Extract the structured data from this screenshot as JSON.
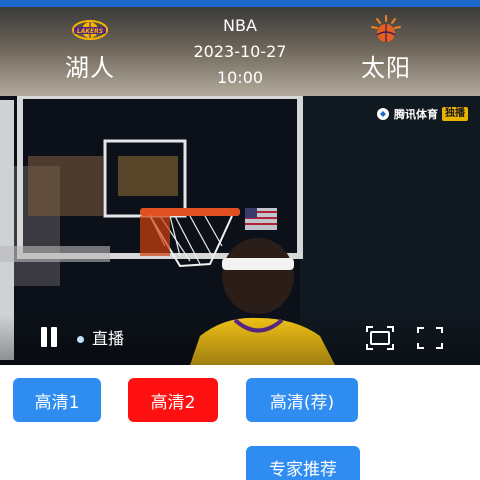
{
  "match": {
    "league": "NBA",
    "date": "2023-10-27",
    "time": "10:00",
    "home_team": {
      "name": "湖人",
      "logo_icon": "lakers-logo-icon"
    },
    "away_team": {
      "name": "太阳",
      "logo_icon": "suns-logo-icon"
    }
  },
  "player": {
    "watermark_text": "腾讯体育",
    "watermark_badge": "独播",
    "live_label": "直播",
    "state": "playing"
  },
  "sources": {
    "buttons": [
      {
        "label": "高清1",
        "color": "#2f8cf0",
        "selected": false
      },
      {
        "label": "高清2",
        "color": "#ff1010",
        "selected": true
      },
      {
        "label": "高清(荐)",
        "color": "#2f8cf0",
        "selected": false
      },
      {
        "label": "专家推荐",
        "color": "#2f8cf0",
        "selected": false
      }
    ]
  },
  "colors": {
    "accent": "#2f8cf0",
    "selected": "#ff1010",
    "status_strip": "#1e68c9"
  }
}
